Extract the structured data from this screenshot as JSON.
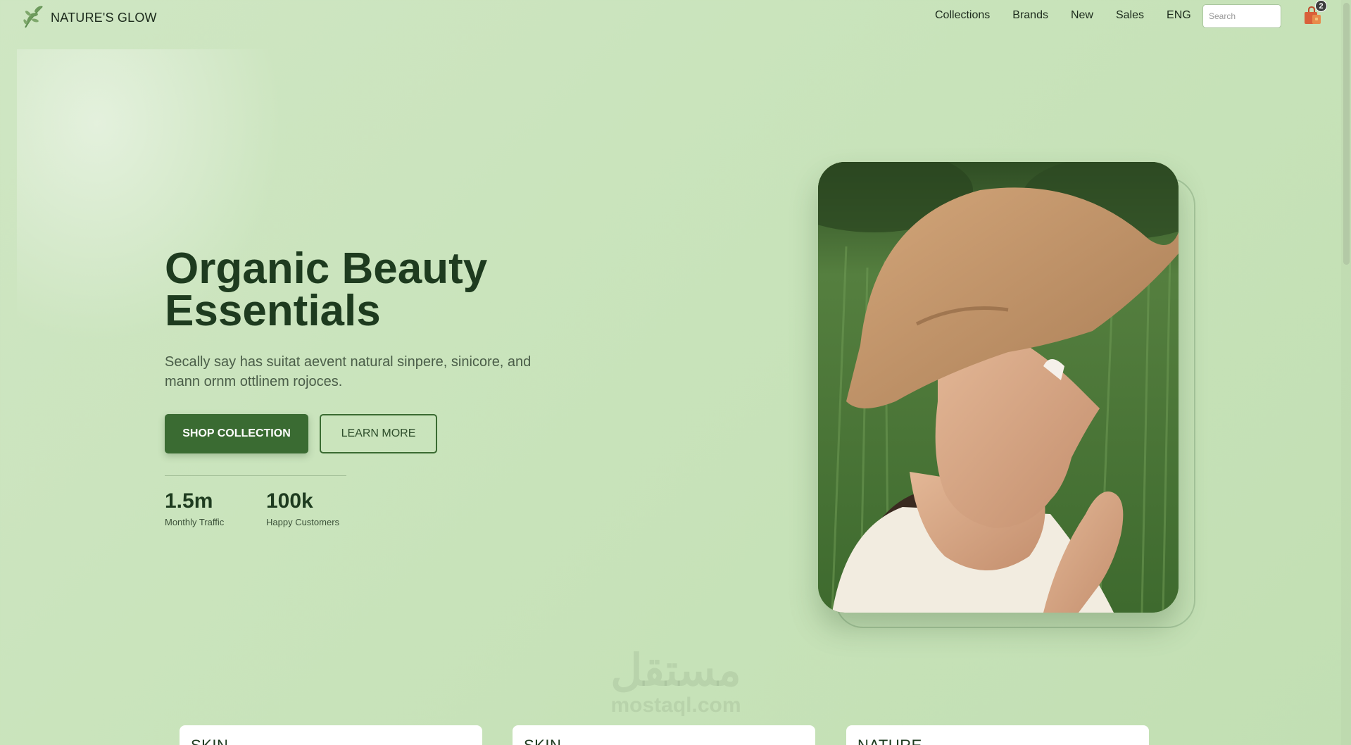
{
  "header": {
    "brand": "NATURE'S GLOW",
    "logo_icon": "leaf-sprig-icon",
    "nav": [
      "Collections",
      "Brands",
      "New",
      "Sales",
      "ENG"
    ],
    "search_placeholder": "Search",
    "cart_icon": "shopping-bag-icon",
    "cart_count": "2"
  },
  "hero": {
    "title_line1": "Organic Beauty",
    "title_line2": "Essentials",
    "subtitle_line1": "Secally say has suitat aevent natural sinpere, sinicore, and",
    "subtitle_line2": "mann ornm ottlinem rojoces.",
    "primary_button": "SHOP COLLECTION",
    "secondary_button": "LEARN MORE",
    "stats": [
      {
        "value": "1.5m",
        "label": "Monthly Traffic"
      },
      {
        "value": "100k",
        "label": "Happy Customers"
      }
    ]
  },
  "cards": [
    "SKIN",
    "SKIN",
    "NATURE"
  ],
  "watermark": {
    "arabic": "مستقل",
    "latin": "mostaql.com"
  },
  "colors": {
    "background": "#c8e3ba",
    "primary": "#3a6b32",
    "heading": "#1e3b1f",
    "cart": "#d9603a"
  }
}
